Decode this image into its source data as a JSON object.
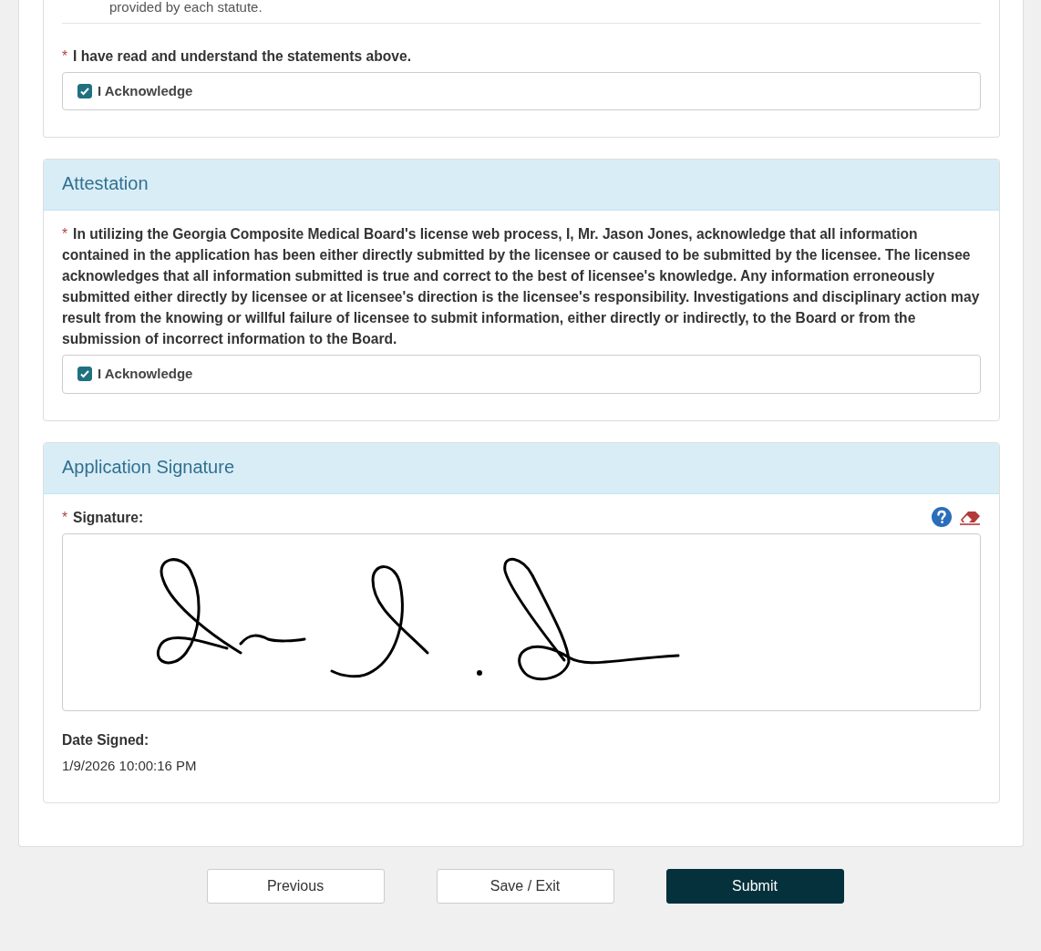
{
  "note": "provided by each statute.",
  "acknowledgement": {
    "required_mark": "*",
    "label": "I have read and understand the statements above.",
    "checkbox": {
      "label": "I Acknowledge",
      "checked": true
    }
  },
  "sections": [
    {
      "kind": "attestation",
      "title": "Attestation",
      "required_mark": "*",
      "statement": "In utilizing the Georgia Composite Medical Board's license web process, I, Mr. Jason Jones, acknowledge that all information contained in the application has been either directly submitted by the licensee or caused to be submitted by the licensee. The licensee acknowledges that all information submitted is true and correct to the best of licensee's knowledge. Any information erroneously submitted either directly by licensee or at licensee's direction is the licensee's responsibility. Investigations and disciplinary action may result from the knowing or willful failure of licensee to submit information, either directly or indirectly, to the Board or from the submission of incorrect information to the Board.",
      "checkbox": {
        "label": "I Acknowledge",
        "checked": true
      }
    },
    {
      "kind": "signature",
      "title": "Application Signature",
      "required_mark": "*",
      "signature_label": "Signature:",
      "date_label": "Date Signed:",
      "date_value": "1/9/2026 10:00:16 PM"
    }
  ],
  "buttons": [
    {
      "label": "Previous",
      "kind": "secondary"
    },
    {
      "label": "Save / Exit",
      "kind": "secondary"
    },
    {
      "label": "Submit",
      "kind": "primary"
    }
  ]
}
